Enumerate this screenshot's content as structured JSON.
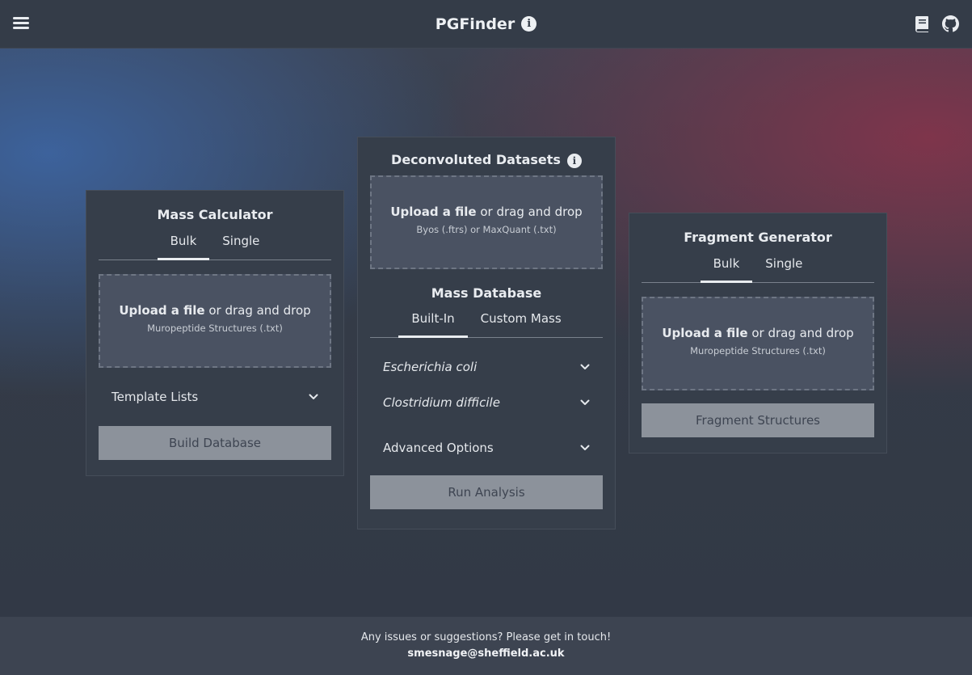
{
  "header": {
    "title": "PGFinder",
    "menu_icon": "hamburger-menu-icon",
    "info_icon": "info-circle-icon",
    "docs_icon": "book-icon",
    "github_icon": "github-icon"
  },
  "mass_calculator": {
    "title": "Mass Calculator",
    "tabs": [
      {
        "label": "Bulk",
        "active": true
      },
      {
        "label": "Single",
        "active": false
      }
    ],
    "upload": {
      "bold": "Upload a file",
      "rest": " or drag and drop",
      "hint": "Muropeptide Structures (.txt)"
    },
    "template_lists_label": "Template Lists",
    "button_label": "Build Database"
  },
  "deconvoluted": {
    "title": "Deconvoluted Datasets",
    "upload": {
      "bold": "Upload a file",
      "rest": " or drag and drop",
      "hint": "Byos (.ftrs) or MaxQuant (.txt)"
    },
    "mass_db_title": "Mass Database",
    "tabs": [
      {
        "label": "Built-In",
        "active": true
      },
      {
        "label": "Custom Mass",
        "active": false
      }
    ],
    "organisms": [
      "Escherichia coli",
      "Clostridium difficile"
    ],
    "advanced_label": "Advanced Options",
    "button_label": "Run Analysis"
  },
  "fragment_generator": {
    "title": "Fragment Generator",
    "tabs": [
      {
        "label": "Bulk",
        "active": true
      },
      {
        "label": "Single",
        "active": false
      }
    ],
    "upload": {
      "bold": "Upload a file",
      "rest": " or drag and drop",
      "hint": "Muropeptide Structures (.txt)"
    },
    "button_label": "Fragment Structures"
  },
  "footer": {
    "message": "Any issues or suggestions? Please get in touch!",
    "email": "smesnage@sheffield.ac.uk"
  },
  "colors": {
    "header_bg": "#343c48",
    "panel_bg": "#363e4a",
    "dropzone_bg": "#4a5262",
    "button_bg": "#8c929b",
    "footer_bg": "#3d4451"
  }
}
